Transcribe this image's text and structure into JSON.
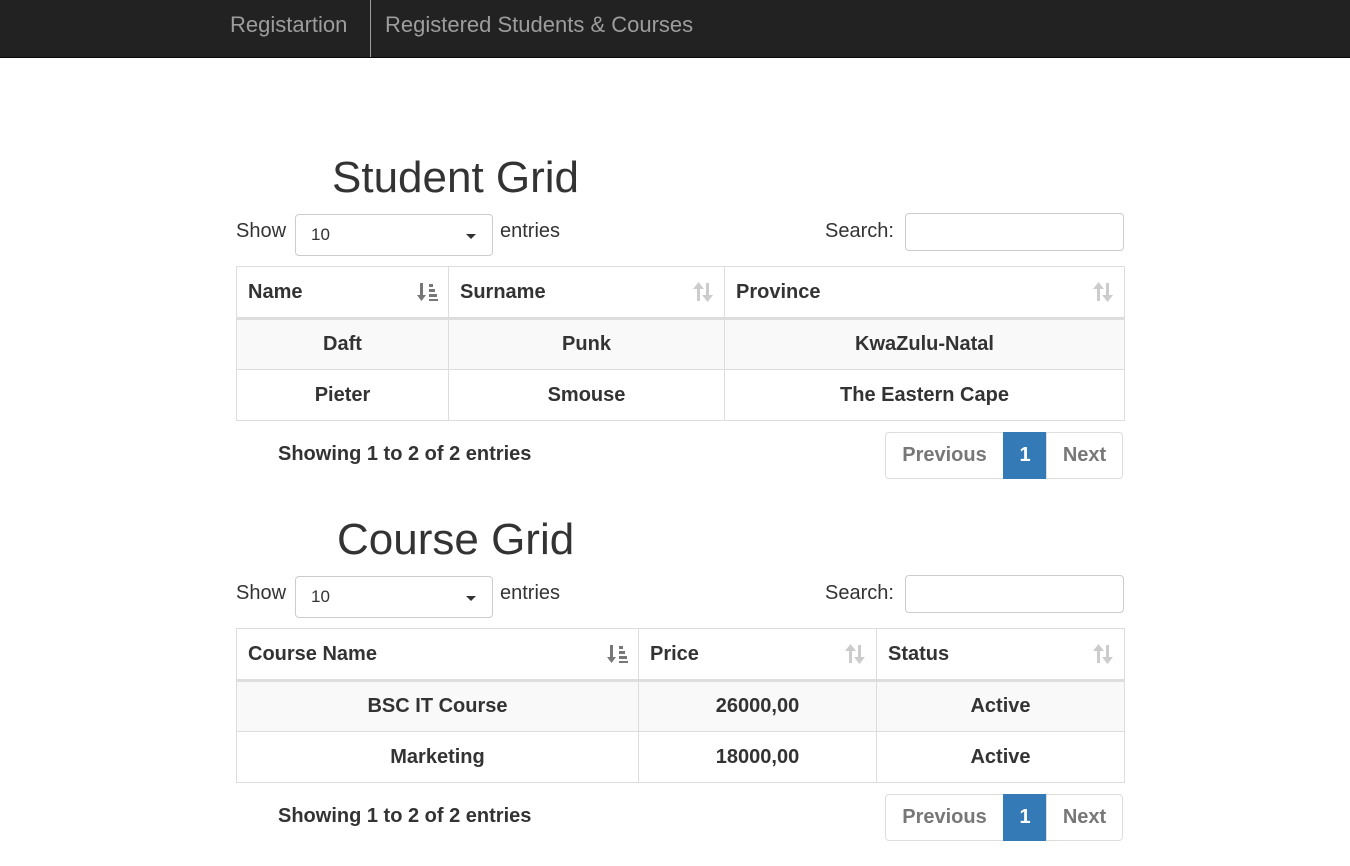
{
  "nav": {
    "links": [
      "Registartion",
      "Registered Students & Courses"
    ]
  },
  "student_grid": {
    "title": "Student Grid",
    "show_label": "Show",
    "length_value": "10",
    "entries_label": "entries",
    "search_label": "Search:",
    "search_value": "",
    "columns": [
      "Name",
      "Surname",
      "Province"
    ],
    "rows": [
      [
        "Daft",
        "Punk",
        "KwaZulu-Natal"
      ],
      [
        "Pieter",
        "Smouse",
        "The Eastern Cape"
      ]
    ],
    "info": "Showing 1 to 2 of 2 entries",
    "pager": {
      "previous": "Previous",
      "current": "1",
      "next": "Next"
    }
  },
  "course_grid": {
    "title": "Course Grid",
    "show_label": "Show",
    "length_value": "10",
    "entries_label": "entries",
    "search_label": "Search:",
    "search_value": "",
    "columns": [
      "Course Name",
      "Price",
      "Status"
    ],
    "rows": [
      [
        "BSC IT Course",
        "26000,00",
        "Active"
      ],
      [
        "Marketing",
        "18000,00",
        "Active"
      ]
    ],
    "info": "Showing 1 to 2 of 2 entries",
    "pager": {
      "previous": "Previous",
      "current": "1",
      "next": "Next"
    }
  },
  "colors": {
    "navbar_bg": "#222222",
    "nav_text": "#9d9d9d",
    "active_page": "#337ab7",
    "border": "#dddddd",
    "stripe": "#f9f9f9"
  }
}
